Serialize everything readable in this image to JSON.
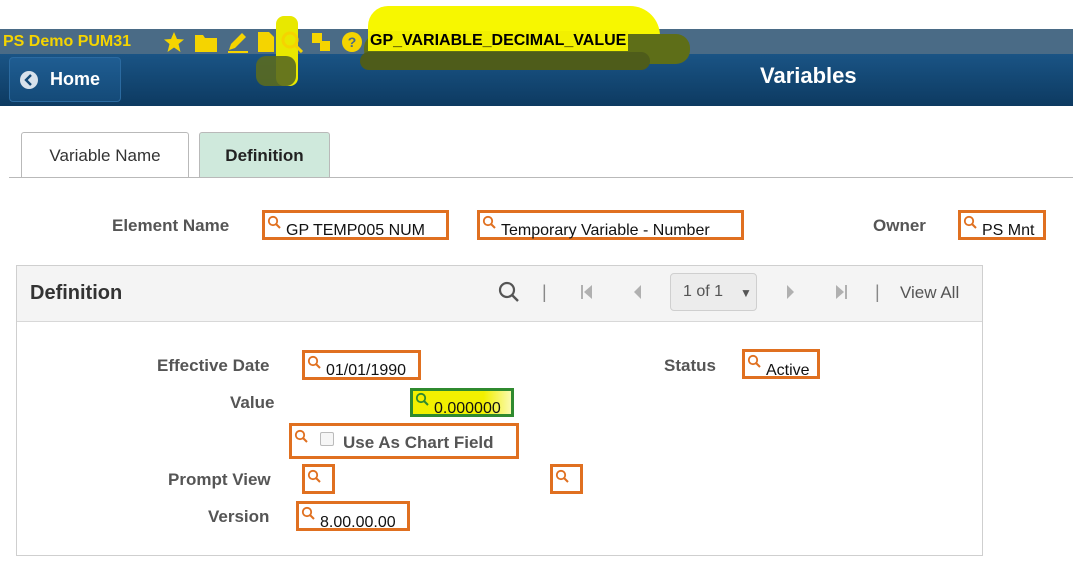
{
  "header": {
    "system_title": "PS Demo PUM31",
    "variable_name": "GP_VARIABLE_DECIMAL_VALUE",
    "home_label": "Home",
    "page_title": "Variables",
    "toolbar_icons": [
      "star-icon",
      "folder-icon",
      "pencil-icon",
      "document-icon",
      "magnifier-icon",
      "tree-icon",
      "help-icon"
    ]
  },
  "tabs": [
    {
      "label": "Variable Name",
      "active": false
    },
    {
      "label": "Definition",
      "active": true
    }
  ],
  "element": {
    "name_label": "Element Name",
    "name_value": "GP TEMP005 NUM",
    "description": "Temporary Variable - Number",
    "owner_label": "Owner",
    "owner_value": "PS Mnt"
  },
  "grid": {
    "title": "Definition",
    "pager": "1 of 1",
    "view_all": "View All",
    "separator": "|"
  },
  "definition": {
    "effective_date_label": "Effective Date",
    "effective_date": "01/01/1990",
    "status_label": "Status",
    "status": "Active",
    "value_label": "Value",
    "value": "0.000000",
    "chart_field_label": "Use As Chart Field",
    "chart_field_checked": false,
    "prompt_view_label": "Prompt View",
    "version_label": "Version",
    "version": "8.00.00.00"
  },
  "colors": {
    "header_bg": "#0d3a61",
    "field_border": "#e07020",
    "value_border": "#2f8a2f",
    "highlight": "#f2f000",
    "active_tab_bg": "#cfe9dc",
    "title_yellow": "#f5d400"
  }
}
